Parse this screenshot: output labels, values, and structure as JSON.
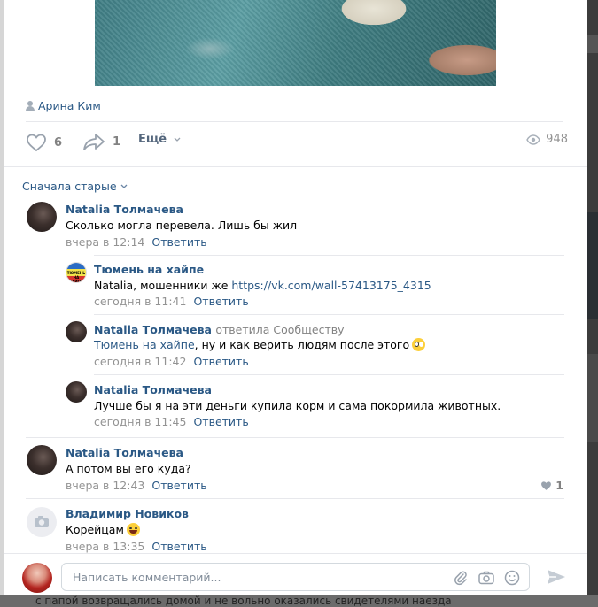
{
  "post": {
    "author": "Арина Ким",
    "likes": "6",
    "shares": "1",
    "more_label": "Ещё",
    "views": "948"
  },
  "comments_sort": "Сначала старые",
  "comments": [
    {
      "name": "Natalia Толмачева",
      "text": "Сколько могла перевела. Лишь бы жил",
      "time": "вчера в 12:14",
      "reply_label": "Ответить"
    },
    {
      "name": "Тюмень на хайпе",
      "text_prefix": "Natalia, мошенники же ",
      "link": "https://vk.com/wall-57413175_4315",
      "time": "сегодня в 11:41",
      "reply_label": "Ответить",
      "avatar_text": "ТЮМЕНЬ НА ХАЙПЕ"
    },
    {
      "name": "Natalia Толмачева",
      "reply_note": "ответила Сообществу",
      "text_mention": "Тюмень на хайпе",
      "text": ", ну и как верить людям после этого",
      "time": "сегодня в 11:42",
      "reply_label": "Ответить"
    },
    {
      "name": "Natalia Толмачева",
      "text": "Лучше бы я на эти деньги купила корм и сама покормила животных.",
      "time": "сегодня в 11:45",
      "reply_label": "Ответить"
    },
    {
      "name": "Natalia Толмачева",
      "text": "А потом вы его куда?",
      "time": "вчера в 12:43",
      "reply_label": "Ответить",
      "likes": "1"
    },
    {
      "name": "Владимир Новиков",
      "text": "Корейцам",
      "time": "вчера в 13:35",
      "reply_label": "Ответить"
    }
  ],
  "composer": {
    "placeholder": "Написать комментарий..."
  },
  "background_text": "с папой возвращались домой и не вольно оказались свидетелями наезда",
  "icons": {
    "author": "person-icon",
    "like": "heart-icon",
    "share": "share-arrow-icon",
    "views": "eye-icon",
    "sort": "chevron-down-icon",
    "attach": "paperclip-icon",
    "camera": "camera-icon",
    "emoji": "smiley-icon",
    "send": "send-icon"
  },
  "colors": {
    "link": "#2a5885",
    "muted": "#939393",
    "divider": "#e7e8ec"
  }
}
